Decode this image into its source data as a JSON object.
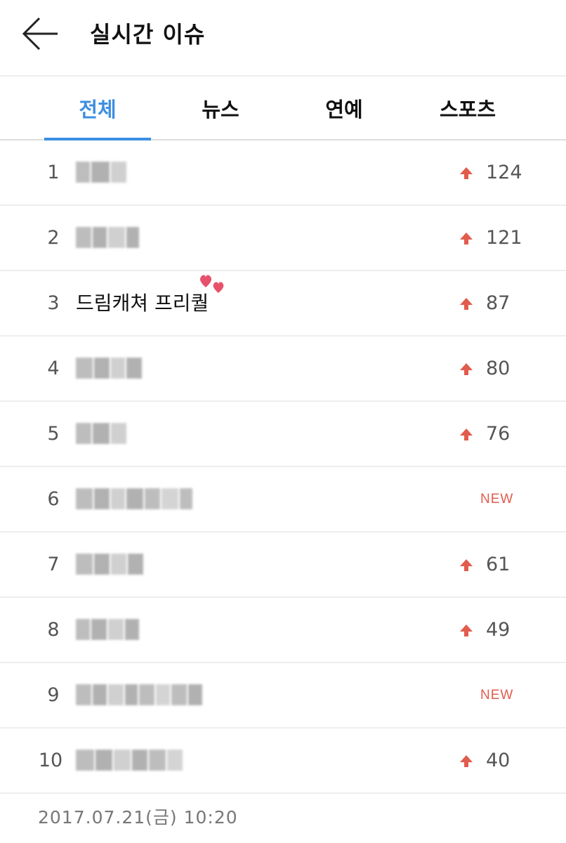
{
  "header": {
    "title": "실시간 이슈"
  },
  "tabs": [
    {
      "label": "전체",
      "active": true
    },
    {
      "label": "뉴스",
      "active": false
    },
    {
      "label": "연예",
      "active": false
    },
    {
      "label": "스포츠",
      "active": false
    }
  ],
  "rows": [
    {
      "rank": "1",
      "term": "",
      "blurred": true,
      "status": "up",
      "change": "124"
    },
    {
      "rank": "2",
      "term": "",
      "blurred": true,
      "status": "up",
      "change": "121"
    },
    {
      "rank": "3",
      "term": "드림캐쳐 프리퀄",
      "blurred": false,
      "status": "up",
      "change": "87"
    },
    {
      "rank": "4",
      "term": "",
      "blurred": true,
      "status": "up",
      "change": "80"
    },
    {
      "rank": "5",
      "term": "",
      "blurred": true,
      "status": "up",
      "change": "76"
    },
    {
      "rank": "6",
      "term": "",
      "blurred": true,
      "status": "new",
      "change": "NEW"
    },
    {
      "rank": "7",
      "term": "",
      "blurred": true,
      "status": "up",
      "change": "61"
    },
    {
      "rank": "8",
      "term": "",
      "blurred": true,
      "status": "up",
      "change": "49"
    },
    {
      "rank": "9",
      "term": "",
      "blurred": true,
      "status": "new",
      "change": "NEW"
    },
    {
      "rank": "10",
      "term": "",
      "blurred": true,
      "status": "up",
      "change": "40"
    }
  ],
  "footer": {
    "timestamp": "2017.07.21(금) 10:20"
  },
  "colors": {
    "accent": "#3d8ee2",
    "up_arrow": "#e25b4c",
    "new_badge": "#e25b4c"
  },
  "icons": {
    "back": "arrow-left-icon",
    "up": "arrow-up-icon",
    "hearts": "hearts-icon"
  }
}
